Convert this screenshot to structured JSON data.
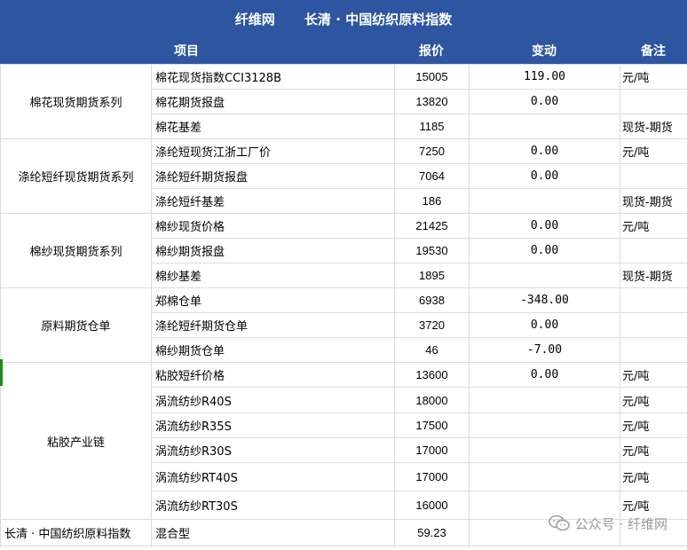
{
  "header": {
    "site": "纤维网",
    "title": "长清 · 中国纺织原料指数",
    "columns": {
      "item": "项目",
      "price": "报价",
      "change": "变动",
      "note": "备注"
    }
  },
  "groups": [
    {
      "name": "棉花现货期货系列",
      "rows": [
        {
          "item": "棉花现货指数CCI3128B",
          "price": "15005",
          "change": "119.00",
          "change_color": "red",
          "note": "元/吨"
        },
        {
          "item": "棉花期货报盘",
          "price": "13820",
          "change": "0.00",
          "change_color": "red",
          "note": ""
        },
        {
          "item": "棉花基差",
          "price": "1185",
          "change": "",
          "change_color": "",
          "note": "现货-期货"
        }
      ]
    },
    {
      "name": "涤纶短纤现货期货系列",
      "rows": [
        {
          "item": "涤纶短现货江浙工厂价",
          "price": "7250",
          "change": "0.00",
          "change_color": "red",
          "note": "元/吨"
        },
        {
          "item": "涤纶短纤期货报盘",
          "price": "7064",
          "change": "0.00",
          "change_color": "red",
          "note": ""
        },
        {
          "item": "涤纶短纤基差",
          "price": "186",
          "change": "",
          "change_color": "",
          "note": "现货-期货"
        }
      ]
    },
    {
      "name": "棉纱现货期货系列",
      "rows": [
        {
          "item": "棉纱现货价格",
          "price": "21425",
          "change": "0.00",
          "change_color": "red",
          "note": "元/吨"
        },
        {
          "item": "棉纱期货报盘",
          "price": "19530",
          "change": "0.00",
          "change_color": "red",
          "note": ""
        },
        {
          "item": "棉纱基差",
          "price": "1895",
          "change": "",
          "change_color": "",
          "note": "现货-期货"
        }
      ]
    },
    {
      "name": "原料期货仓单",
      "rows": [
        {
          "item": "郑棉仓单",
          "price": "6938",
          "change": "-348.00",
          "change_color": "green",
          "note": "",
          "price_color": "gray"
        },
        {
          "item": "涤纶短纤期货仓单",
          "price": "3720",
          "change": "0.00",
          "change_color": "red",
          "note": ""
        },
        {
          "item": "棉纱期货仓单",
          "price": "46",
          "change": "-7.00",
          "change_color": "green",
          "note": ""
        }
      ]
    },
    {
      "name": "粘胶产业链",
      "rows": [
        {
          "item": "粘胶短纤价格",
          "price": "13600",
          "change": "0.00",
          "change_color": "red",
          "note": "元/吨"
        },
        {
          "item": "涡流纺纱R40S",
          "price": "18000",
          "change": "",
          "change_color": "",
          "note": "元/吨"
        },
        {
          "item": "涡流纺纱R35S",
          "price": "17500",
          "change": "",
          "change_color": "",
          "note": "元/吨"
        },
        {
          "item": "涡流纺纱R30S",
          "price": "17000",
          "change": "",
          "change_color": "",
          "note": "元/吨"
        },
        {
          "item": "涡流纺纱RT40S",
          "price": "17000",
          "change": "",
          "change_color": "",
          "note": "元/吨"
        },
        {
          "item": "涡流纺纱RT30S",
          "price": "16000",
          "change": "",
          "change_color": "",
          "note": "元/吨"
        }
      ]
    }
  ],
  "footer": {
    "label": "长清 · 中国纺织原料指数",
    "item": "混合型",
    "price": "59.23"
  },
  "watermark": {
    "text": "公众号 · 纤维网",
    "icon": "wechat-icon"
  },
  "colors": {
    "header_bg": "#2e55a0",
    "up": "#e02424",
    "down": "#1a8a1a"
  }
}
